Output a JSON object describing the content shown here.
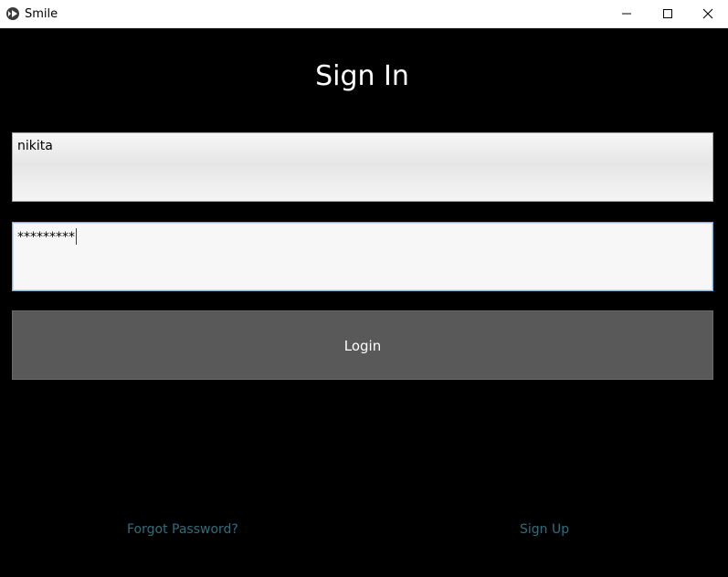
{
  "window": {
    "title": "Smile",
    "app_icon": "kivy-logo-icon",
    "controls": [
      "minimize-icon",
      "maximize-icon",
      "close-icon"
    ]
  },
  "page": {
    "heading": "Sign In"
  },
  "form": {
    "username_value": "nikita",
    "password_value": "*********",
    "login_label": "Login"
  },
  "links": {
    "forgot_password": "Forgot Password?",
    "sign_up": "Sign Up"
  },
  "colors": {
    "background": "#000000",
    "button": "#595959",
    "link": "#2f6e7e",
    "caret": "#cc0000",
    "focus_border": "#7fb2d4"
  }
}
